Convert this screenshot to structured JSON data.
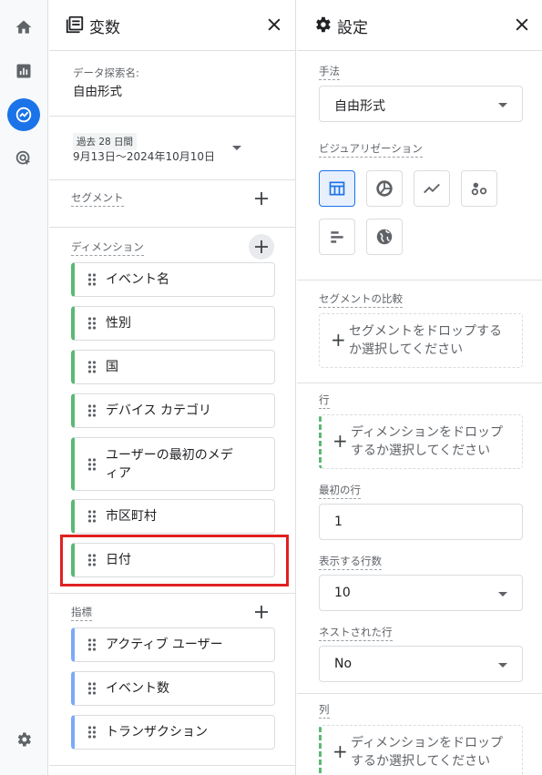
{
  "rail": {
    "items": [
      {
        "icon": "home-icon"
      },
      {
        "icon": "reports-icon"
      },
      {
        "icon": "explore-icon",
        "active": true
      },
      {
        "icon": "advertising-icon"
      }
    ],
    "bottom_icon": "settings-gear-icon"
  },
  "variables": {
    "title": "変数",
    "exploration_name_label": "データ探索名:",
    "exploration_name": "自由形式",
    "date_chip": "過去 28 日間",
    "date_range": "9月13日～2024年10月10日",
    "segment_label": "セグメント",
    "dimension_label": "ディメンション",
    "dimensions": [
      {
        "label": "イベント名"
      },
      {
        "label": "性別"
      },
      {
        "label": "国"
      },
      {
        "label": "デバイス カテゴリ"
      },
      {
        "label": "ユーザーの最初のメデ\nィア"
      },
      {
        "label": "市区町村"
      },
      {
        "label": "日付"
      }
    ],
    "metric_label": "指標",
    "metrics": [
      {
        "label": "アクティブ ユーザー"
      },
      {
        "label": "イベント数"
      },
      {
        "label": "トランザクション"
      }
    ]
  },
  "settings": {
    "title": "設定",
    "technique_label": "手法",
    "technique_value": "自由形式",
    "visualization_label": "ビジュアリゼーション",
    "visualizations": [
      "table-icon",
      "donut-chart-icon",
      "line-chart-icon",
      "scatter-plot-icon",
      "bar-chart-icon",
      "geo-map-icon"
    ],
    "segment_compare_label": "セグメントの比較",
    "segment_drop_text": "セグメントをドロップするか選択してください",
    "rows_label": "行",
    "rows_drop_text": "ディメンションをドロップするか選択してください",
    "first_row_label": "最初の行",
    "first_row_value": "1",
    "show_rows_label": "表示する行数",
    "show_rows_value": "10",
    "nested_rows_label": "ネストされた行",
    "nested_rows_value": "No",
    "columns_label": "列",
    "columns_drop_text": "ディメンションをドロップするか選択してください"
  },
  "colors": {
    "accent": "#1a73e8",
    "dimension_accent": "#5bb974",
    "metric_accent": "#7baaf7",
    "highlight": "#e02020"
  }
}
